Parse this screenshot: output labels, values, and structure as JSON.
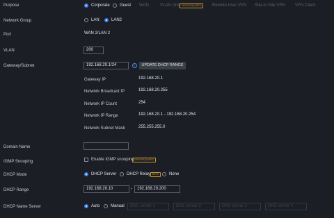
{
  "purpose": {
    "label": "Purpose",
    "options": [
      "Corporate",
      "Guest",
      "WAN",
      "VLAN Only",
      "Remote User VPN",
      "Site-to-Site VPN",
      "VPN Client"
    ],
    "selected": "Corporate",
    "vlan_only_badge": "VIEW REQUIRED"
  },
  "network_group": {
    "label": "Network Group",
    "options": [
      "LAN",
      "LAN2"
    ],
    "selected": "LAN2"
  },
  "port": {
    "label": "Port",
    "value": "WAN 2/LAN 2"
  },
  "vlan": {
    "label": "VLAN",
    "value": "200"
  },
  "gateway": {
    "label": "Gateway/Subnet",
    "value": "192.168.20.1/24",
    "update_button": "UPDATE DHCP RANGE",
    "info_icon": "info-icon"
  },
  "details": [
    {
      "label": "Gateway IP",
      "value": "192.168.20.1"
    },
    {
      "label": "Network Broadcast IP",
      "value": "192.168.20.255"
    },
    {
      "label": "Network IP Count",
      "value": "254"
    },
    {
      "label": "Network IP Range",
      "value": "192.168.20.1 - 192.168.20.254"
    },
    {
      "label": "Network Subnet Mask",
      "value": "255.255.255.0"
    }
  ],
  "domain_name": {
    "label": "Domain Name",
    "value": ""
  },
  "igmp": {
    "label": "IGMP Snooping",
    "checkbox_label": "Enable IGMP snooping",
    "badge": "VIEW REQUIRED",
    "checked": false
  },
  "dhcp_mode": {
    "label": "DHCP Mode",
    "options": [
      "DHCP Server",
      "DHCP Relay",
      "None"
    ],
    "selected": "DHCP Server",
    "relay_badge": "BETA"
  },
  "dhcp_range": {
    "label": "DHCP Range",
    "start": "192.168.20.10",
    "separator": "-",
    "end": "192.168.20.200"
  },
  "dhcp_name_server": {
    "label": "DHCP Name Server",
    "options": [
      "Auto",
      "Manual"
    ],
    "selected": "Auto",
    "placeholders": [
      "DNS server 1",
      "DNS server 2",
      "DNS server 3",
      "DNS server 4"
    ]
  },
  "colors": {
    "accent": "#3d7de8",
    "background": "#1b1e25",
    "badge": "#c9962e",
    "button": "#3b3f47"
  }
}
